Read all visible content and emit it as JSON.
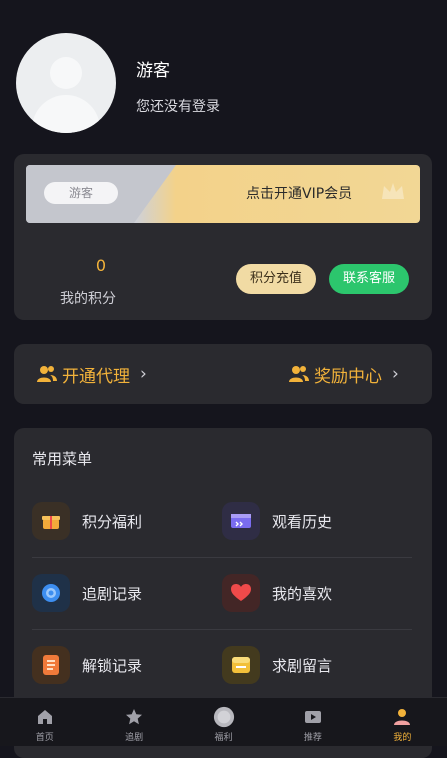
{
  "profile": {
    "name": "游客",
    "subtitle": "您还没有登录"
  },
  "vip": {
    "badge": "游客",
    "cta": "点击开通VIP会员"
  },
  "points": {
    "value": "0",
    "label": "我的积分",
    "recharge_label": "积分充值",
    "service_label": "联系客服"
  },
  "links": [
    {
      "label": "开通代理",
      "icon": "users-icon"
    },
    {
      "label": "奖励中心",
      "icon": "users-icon"
    }
  ],
  "menu": {
    "title": "常用菜单",
    "items": [
      {
        "label": "积分福利",
        "icon": "gift-icon",
        "color": "#f2a93a"
      },
      {
        "label": "观看历史",
        "icon": "history-icon",
        "color": "#7a6cf0"
      },
      {
        "label": "追剧记录",
        "icon": "target-icon",
        "color": "#3d8ef0"
      },
      {
        "label": "我的喜欢",
        "icon": "heart-icon",
        "color": "#ef4a4a"
      },
      {
        "label": "解锁记录",
        "icon": "document-icon",
        "color": "#f07a3a"
      },
      {
        "label": "求剧留言",
        "icon": "message-icon",
        "color": "#f2c03a"
      }
    ]
  },
  "tabs": [
    {
      "label": "首页",
      "icon": "home-icon",
      "active": false
    },
    {
      "label": "追剧",
      "icon": "star-icon",
      "active": false
    },
    {
      "label": "福利",
      "icon": "welfare-icon",
      "active": false
    },
    {
      "label": "推荐",
      "icon": "play-icon",
      "active": false
    },
    {
      "label": "我的",
      "icon": "user-icon",
      "active": true
    }
  ],
  "colors": {
    "accent": "#f2b23a",
    "green": "#2cc66d",
    "background": "#15151d",
    "card": "#2a2a2f"
  }
}
